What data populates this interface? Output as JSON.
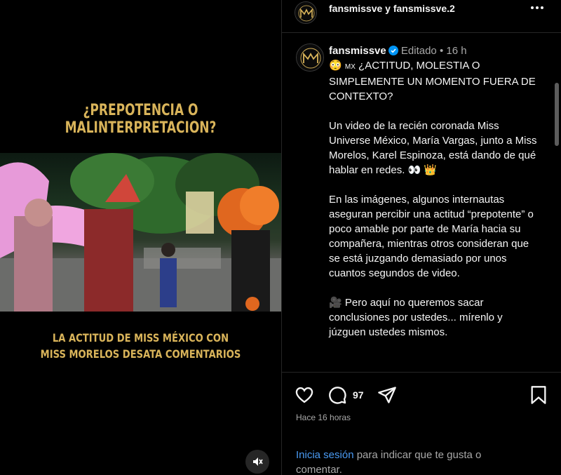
{
  "media": {
    "headline_top": "¿PREPOTENCIA O MALINTERPRETACION?",
    "headline_bottom_1": "LA ACTITUD DE MISS MÉXICO CON",
    "headline_bottom_2": "MISS MORELOS DESATA COMENTARIOS",
    "mute_icon": "speaker-muted-icon"
  },
  "header": {
    "names": "fansmissve y fansmissve.2",
    "more_icon": "more-horizontal-icon"
  },
  "caption": {
    "username": "fansmissve",
    "edited": "Editado",
    "dot": "•",
    "age": "16 h",
    "line1_emoji": "😳",
    "line1_flag": "MX",
    "title": "¿ACTITUD, MOLESTIA O SIMPLEMENTE UN MOMENTO FUERA DE CONTEXTO?",
    "para2": "Un video de la recién coronada Miss Universe México, María Vargas, junto a Miss Morelos, Karel Espinoza, está dando de qué hablar en redes.",
    "para2_emojis": "👀 👑",
    "para3": "En las imágenes, algunos internautas aseguran percibir una actitud “prepotente” o poco amable por parte de María hacia su compañera, mientras otros consideran que se está juzgando demasiado por unos cuantos segundos de video.",
    "para4_emoji": "🎥",
    "para4": "Pero aquí no queremos sacar conclusiones por ustedes... mírenlo y júzguen ustedes mismos."
  },
  "actions": {
    "comment_count": "97",
    "time_ago": "Hace 16 horas",
    "login_link": "Inicia sesión",
    "login_rest": " para indicar que te gusta o comentar."
  },
  "colors": {
    "gold": "#d9b45a",
    "link": "#4a9bf4",
    "muted": "#a8a8a8",
    "verified": "#0095f6"
  }
}
